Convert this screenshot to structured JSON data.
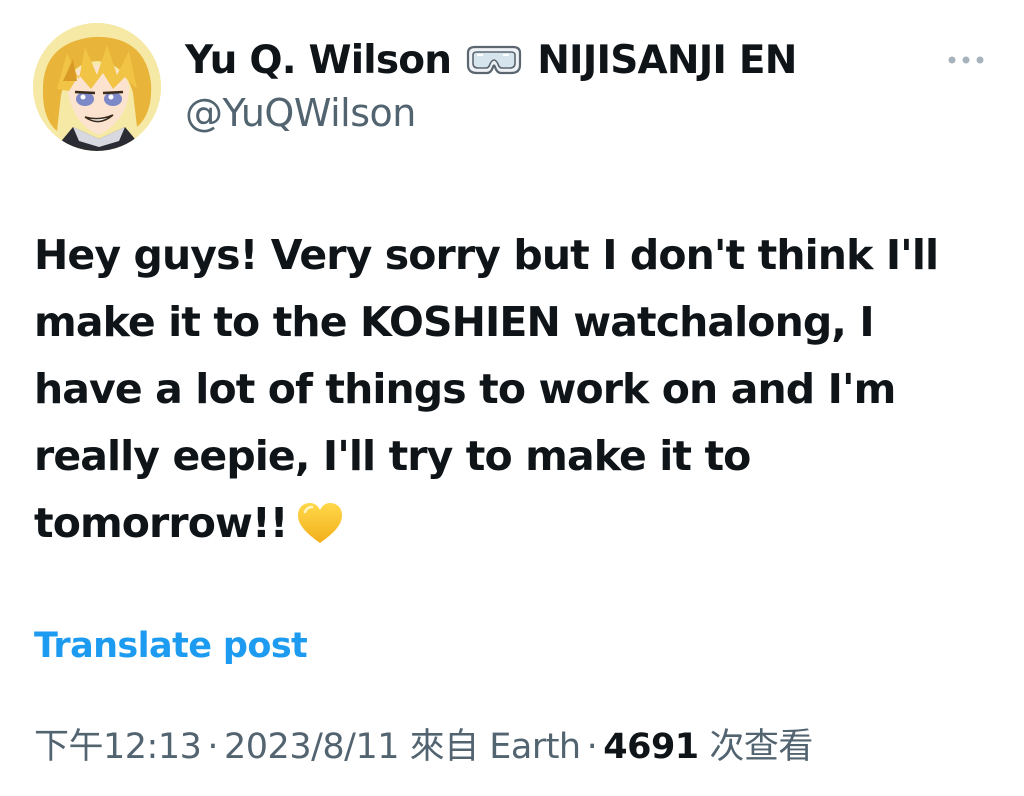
{
  "author": {
    "display_name": "Yu Q. Wilson",
    "badge_icon": "goggles-icon",
    "affiliation": "NIJISANJI EN",
    "handle": "@YuQWilson",
    "avatar_icon": "avatar"
  },
  "header": {
    "more_icon": "more-options-icon"
  },
  "tweet": {
    "text": "Hey guys! Very sorry but I don't think I'll\nmake it to the KOSHIEN watchalong, I\nhave a lot of things to work on and I'm\nreally eepie, I'll try to make it to\ntomorrow!!",
    "emoji_icon": "yellow-heart-icon",
    "emoji_color": "#f8c21e"
  },
  "actions": {
    "translate_label": "Translate post"
  },
  "meta": {
    "time": "下午12:13",
    "separator": "·",
    "date": "2023/8/11",
    "source": "來自 Earth",
    "views_count": "4691",
    "views_label": "次查看"
  },
  "colors": {
    "text_primary": "#0f1419",
    "text_secondary": "#536471",
    "link": "#1d9bf0"
  }
}
